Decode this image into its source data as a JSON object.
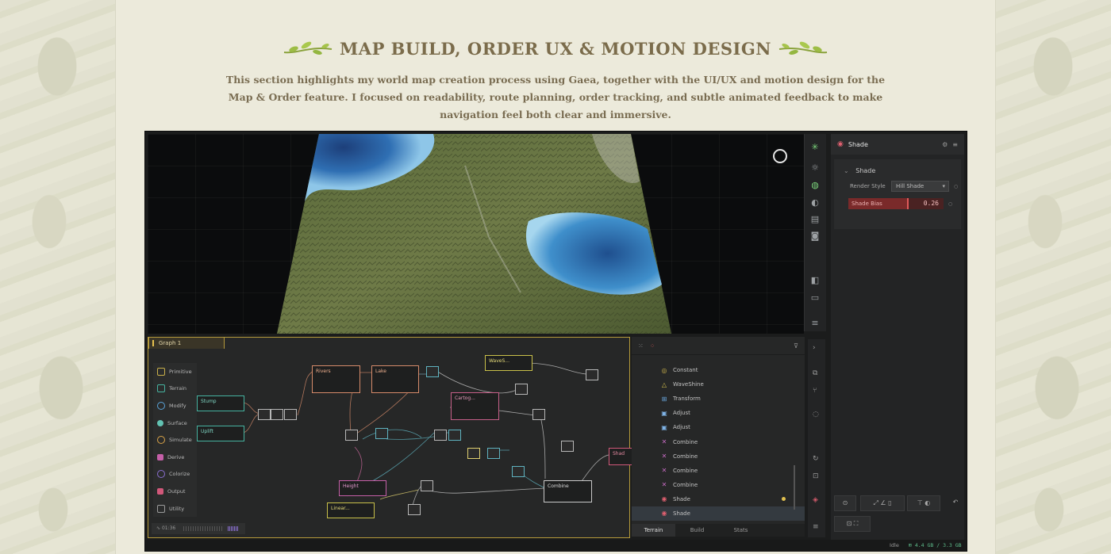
{
  "header": {
    "title": "MAP BUILD, ORDER UX & MOTION DESIGN",
    "subtitle": "This section highlights my world map creation process using Gaea, together with the UI/UX and motion design for the Map & Order feature. I focused on readability, route planning, order tracking, and subtle animated feedback to make navigation feel both clear and immersive."
  },
  "app": {
    "properties": {
      "node_name": "Shade",
      "section": "Shade",
      "render_style_label": "Render Style",
      "render_style_value": "Hill Shade",
      "shade_bias_label": "Shade Bias",
      "shade_bias_value": "0.26",
      "shade_bias_fraction": 0.62
    },
    "graph": {
      "tab": "Graph 1",
      "palette": [
        {
          "label": "Primitive",
          "color": "#c9b04a"
        },
        {
          "label": "Terrain",
          "color": "#46b3a0"
        },
        {
          "label": "Modify",
          "color": "#5aa3d8"
        },
        {
          "label": "Surface",
          "color": "#62c2b2"
        },
        {
          "label": "Simulate",
          "color": "#d9a348"
        },
        {
          "label": "Derive",
          "color": "#c55fa8"
        },
        {
          "label": "Colorize",
          "color": "#8a6fd1"
        },
        {
          "label": "Output",
          "color": "#d1587a"
        },
        {
          "label": "Utility",
          "color": "#9b9b9b"
        }
      ],
      "timer": "01:36",
      "nodes": {
        "stump": "Stump",
        "uplift": "Uplift",
        "rivers": "Rivers",
        "lake": "Lake",
        "waves": "WaveS...",
        "cartog": "Cartog...",
        "height": "Height",
        "linear": "Linear...",
        "combine": "Combine",
        "shade_cut": "Shad"
      }
    },
    "library": {
      "items": [
        {
          "label": "Constant",
          "icon": "◎",
          "color": "#c9b04a"
        },
        {
          "label": "WaveShine",
          "icon": "△",
          "color": "#d8c44f"
        },
        {
          "label": "Transform",
          "icon": "⊞",
          "color": "#6aa8e0"
        },
        {
          "label": "Adjust",
          "icon": "▣",
          "color": "#7fb3e6"
        },
        {
          "label": "Adjust",
          "icon": "▣",
          "color": "#7fb3e6"
        },
        {
          "label": "Combine",
          "icon": "✕",
          "color": "#c56bc1"
        },
        {
          "label": "Combine",
          "icon": "✕",
          "color": "#c56bc1"
        },
        {
          "label": "Combine",
          "icon": "✕",
          "color": "#c56bc1"
        },
        {
          "label": "Combine",
          "icon": "✕",
          "color": "#c56bc1"
        },
        {
          "label": "Shade",
          "icon": "◉",
          "color": "#e06070"
        },
        {
          "label": "Shade",
          "icon": "◉",
          "color": "#e06070"
        }
      ],
      "tabs": [
        "Terrain",
        "Build",
        "Stats"
      ]
    },
    "status": {
      "state": "Idle",
      "memory": "4.4 GB / 3.3 GB"
    }
  }
}
